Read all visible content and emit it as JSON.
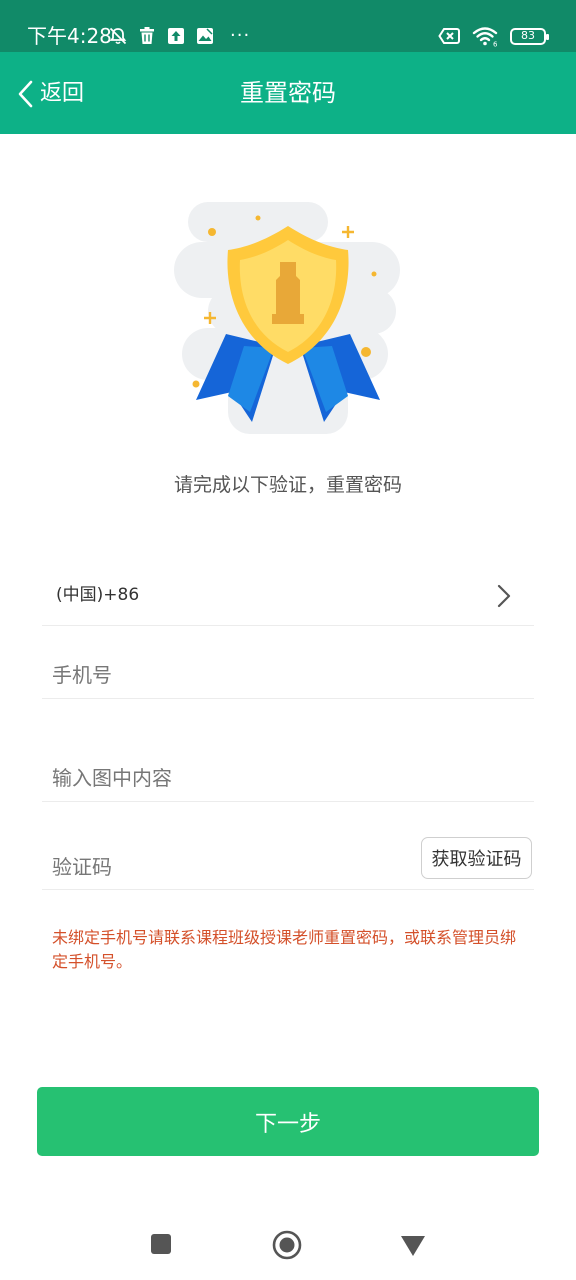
{
  "status_bar": {
    "time": "下午4:28",
    "left_icons": [
      "notification-off-icon",
      "trash-icon",
      "upload-icon",
      "image-icon"
    ],
    "overflow": "···",
    "right_icons": [
      "no-sim-icon",
      "wifi-icon"
    ],
    "battery": "83"
  },
  "nav": {
    "back_label": "返回",
    "title": "重置密码"
  },
  "illustration": {
    "icon": "medal-badge-icon",
    "colors": {
      "medal": "#ffd34d",
      "ribbon": "#1565d8",
      "cloud": "#eef0f2"
    }
  },
  "subtitle": "请完成以下验证，重置密码",
  "form": {
    "country_code": "(中国)+86",
    "phone_placeholder": "手机号",
    "captcha_placeholder": "输入图中内容",
    "code_placeholder": "验证码",
    "get_code_label": "获取验证码"
  },
  "notice": "未绑定手机号请联系课程班级授课老师重置密码，或联系管理员绑定手机号。",
  "next_button": "下一步",
  "colors": {
    "status_bar": "#118a68",
    "nav_bar": "#0db187",
    "primary_button": "#26c172",
    "notice_text": "#d4502a"
  },
  "system_nav": [
    "recents-square-icon",
    "home-circle-icon",
    "back-triangle-icon"
  ]
}
